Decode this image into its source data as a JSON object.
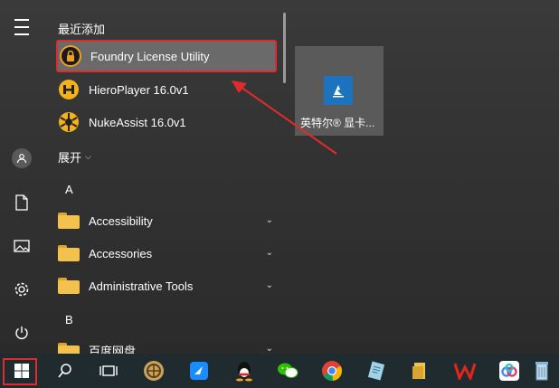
{
  "recent": {
    "title": "最近添加",
    "items": [
      {
        "label": "Foundry License Utility",
        "icon": "foundry-license-icon"
      },
      {
        "label": "HieroPlayer 16.0v1",
        "icon": "hieroplayer-icon"
      },
      {
        "label": "NukeAssist 16.0v1",
        "icon": "nukeassist-icon"
      }
    ]
  },
  "expand": {
    "label": "展开"
  },
  "groups": [
    {
      "letter": "A",
      "items": [
        {
          "label": "Accessibility",
          "icon": "folder-icon"
        },
        {
          "label": "Accessories",
          "icon": "folder-icon"
        },
        {
          "label": "Administrative Tools",
          "icon": "folder-icon"
        }
      ]
    },
    {
      "letter": "B",
      "items": [
        {
          "label": "百度网盘",
          "icon": "folder-icon"
        }
      ]
    }
  ],
  "tile": {
    "label": "英特尔® 显卡...",
    "icon": "intel-graphics-icon",
    "color": "#1e73be"
  },
  "rail": [
    "hamburger-menu-icon",
    "user-icon",
    "documents-icon",
    "pictures-icon",
    "settings-icon",
    "power-icon"
  ],
  "taskbar": [
    "windows-start-icon",
    "search-icon",
    "task-view-icon",
    "app-circle-icon",
    "feishu-icon",
    "qq-icon",
    "wechat-icon",
    "chrome-icon",
    "notepad-icon",
    "file-explorer-icon",
    "wps-icon",
    "baidu-netdisk-icon",
    "recycle-bin-icon"
  ],
  "colors": {
    "highlight_border": "#e12b2b",
    "annotation_arrow": "#e12b2b"
  }
}
